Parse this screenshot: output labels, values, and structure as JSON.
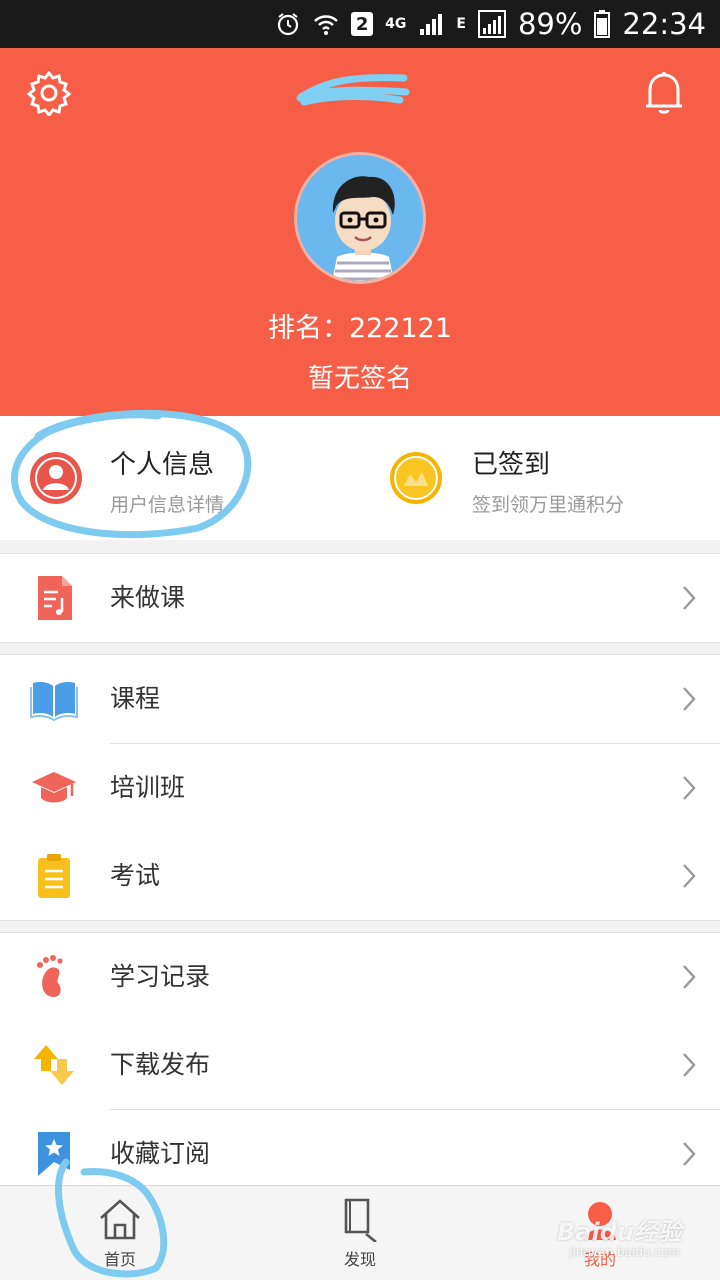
{
  "status_bar": {
    "network_4g": "4G",
    "network_e": "E",
    "sim": "2",
    "battery": "89%",
    "time": "22:34"
  },
  "header": {
    "rank": "排名：222121",
    "signature": "暂无签名"
  },
  "info_row": {
    "personal": {
      "title": "个人信息",
      "subtitle": "用户信息详情"
    },
    "checkin": {
      "title": "已签到",
      "subtitle": "签到领万里通积分"
    }
  },
  "menu": {
    "group1": [
      {
        "label": "来做课",
        "icon": "document-music-icon"
      }
    ],
    "group2": [
      {
        "label": "课程",
        "icon": "book-icon"
      },
      {
        "label": "培训班",
        "icon": "graduation-cap-icon"
      },
      {
        "label": "考试",
        "icon": "clipboard-icon"
      }
    ],
    "group3": [
      {
        "label": "学习记录",
        "icon": "footprint-icon"
      },
      {
        "label": "下载发布",
        "icon": "up-down-arrows-icon"
      },
      {
        "label": "收藏订阅",
        "icon": "bookmark-star-icon"
      }
    ]
  },
  "bottom_nav": {
    "home": "首页",
    "discover": "发现",
    "mine": "我的"
  },
  "watermark": {
    "text": "Baidu经验",
    "sub": "jingyan.baidu.com"
  },
  "colors": {
    "accent": "#f65e48",
    "annotation": "#7ecbef"
  }
}
